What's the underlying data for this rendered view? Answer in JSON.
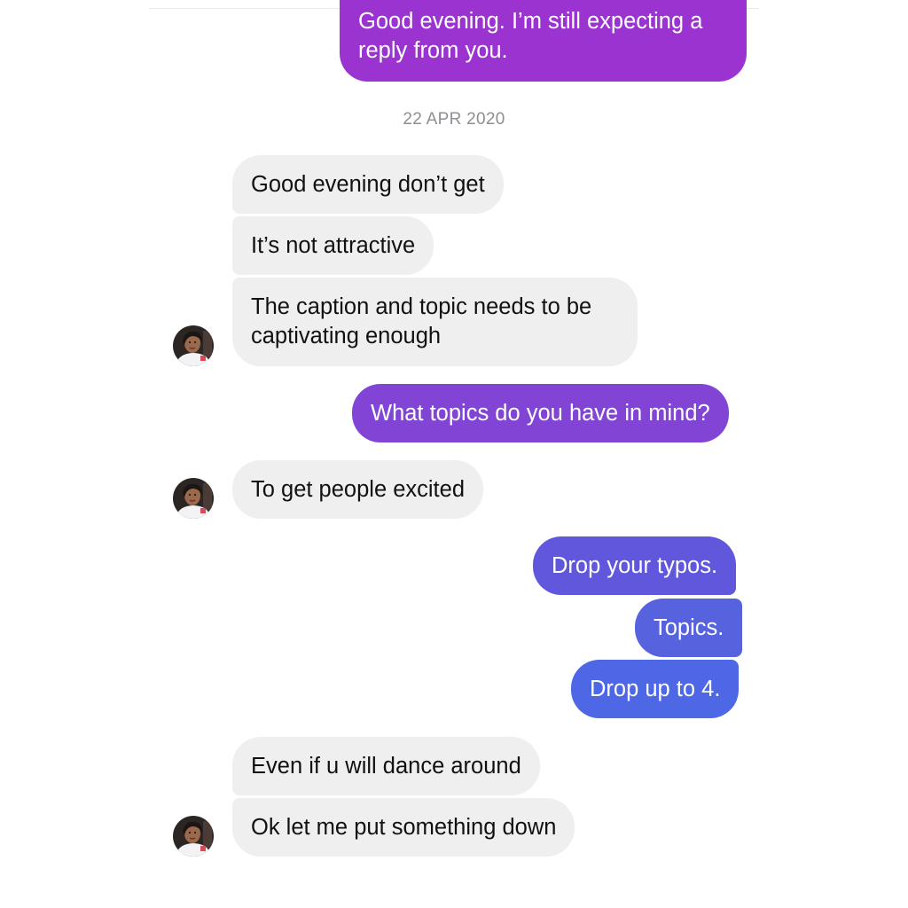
{
  "conversation": {
    "date_separator": "22 APR 2020",
    "messages": [
      {
        "side": "out",
        "text_lines": [
          "Good evening. I’m still expecting a",
          "reply from you."
        ]
      },
      {
        "side": "in",
        "text": "Good evening don’t get"
      },
      {
        "side": "in",
        "text": "It’s not attractive"
      },
      {
        "side": "in",
        "text_lines": [
          "The caption and topic needs to be",
          "captivating enough"
        ]
      },
      {
        "side": "out",
        "text": "What topics do you have in mind?"
      },
      {
        "side": "in",
        "text": "To get people excited"
      },
      {
        "side": "out",
        "text": "Drop your typos."
      },
      {
        "side": "out",
        "text": "Topics."
      },
      {
        "side": "out",
        "text": "Drop up to 4."
      },
      {
        "side": "in",
        "text": "Even if u will dance around"
      },
      {
        "side": "in",
        "text": "Ok let me put something down"
      }
    ]
  },
  "colors": {
    "incoming_bubble": "#efefef",
    "outgoing_gradient_top": "#a333c8",
    "outgoing_gradient_bottom": "#4f66e6"
  },
  "icons": {
    "avatar": "user-avatar-photo"
  }
}
